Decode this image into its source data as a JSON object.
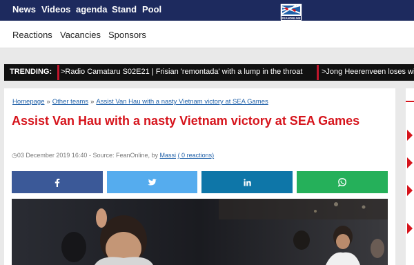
{
  "topnav": {
    "items": [
      "News",
      "Videos",
      "agenda",
      "Stand",
      "Pool"
    ],
    "logo_text": "FEANONLINE"
  },
  "subnav": {
    "items": [
      "Reactions",
      "Vacancies",
      "Sponsors"
    ]
  },
  "trending": {
    "label": "TRENDING:",
    "items": [
      ">Radio Camataru S02E21 | Frisian 'remontada' with a lump in the throat",
      ">Jong Heerenveen loses wi"
    ]
  },
  "breadcrumb": {
    "items": [
      "Homepage",
      "Other teams",
      "Assist Van Hau with a nasty Vietnam victory at SEA Games"
    ],
    "separator": "»"
  },
  "article": {
    "title": "Assist Van Hau with a nasty Vietnam victory at SEA Games",
    "date": "03 December 2019 16:40",
    "source_text": "- Source: FeanOnline, by",
    "author": "Massi",
    "reactions": "( 0 reactions)"
  },
  "share": {
    "buttons": [
      {
        "name": "facebook",
        "icon": "facebook-icon",
        "color": "#3b5998"
      },
      {
        "name": "twitter",
        "icon": "twitter-icon",
        "color": "#55acee"
      },
      {
        "name": "linkedin",
        "icon": "linkedin-icon",
        "color": "#0e76a8"
      },
      {
        "name": "whatsapp",
        "icon": "whatsapp-icon",
        "color": "#25b05a"
      }
    ]
  },
  "colors": {
    "nav": "#1d2a5e",
    "accent": "#d6141c",
    "link": "#1e5fa8"
  }
}
